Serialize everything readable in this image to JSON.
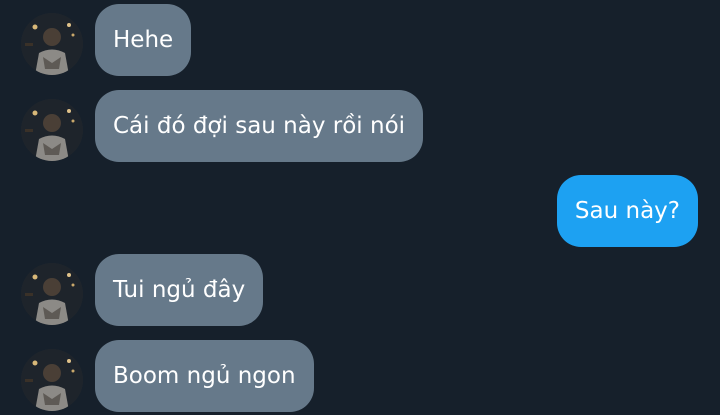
{
  "conversation": {
    "messages": [
      {
        "sender": "other",
        "text": "Hehe"
      },
      {
        "sender": "other",
        "text": "Cái đó đợi sau này rồi nói"
      },
      {
        "sender": "me",
        "text": "Sau này?"
      },
      {
        "sender": "other",
        "text": "Tui ngủ đây"
      },
      {
        "sender": "other",
        "text": "Boom ngủ ngon"
      }
    ]
  },
  "colors": {
    "background": "#16202b",
    "incoming_bubble": "#66798a",
    "outgoing_bubble": "#1da1f2",
    "text": "#ffffff"
  },
  "avatar_icon": "user-avatar-photo"
}
